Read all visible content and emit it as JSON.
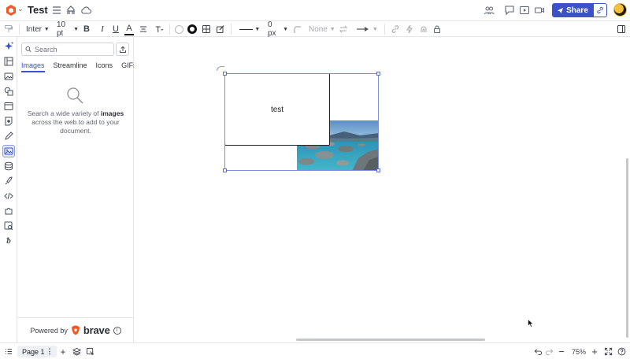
{
  "app": {
    "doc_title": "Test",
    "share_label": "Share"
  },
  "toolbar": {
    "font": "Inter",
    "font_size": "10 pt",
    "stroke_width": "0 px",
    "arrow_style": "None"
  },
  "panel": {
    "search_placeholder": "Search",
    "tabs": [
      {
        "label": "Images",
        "active": true
      },
      {
        "label": "Streamline",
        "active": false
      },
      {
        "label": "Icons",
        "active": false
      },
      {
        "label": "GIFs",
        "active": false
      }
    ],
    "empty_text_1": "Search a wide variety of ",
    "empty_text_bold": "images",
    "empty_text_2": " across the web to add to your document.",
    "powered_by": "Powered by",
    "powered_brand": "brave"
  },
  "canvas": {
    "shape_text": "test"
  },
  "bottombar": {
    "page_label": "Page 1",
    "zoom": "75%"
  },
  "colors": {
    "accent": "#3d52c9",
    "selection": "#7f8fe0"
  }
}
